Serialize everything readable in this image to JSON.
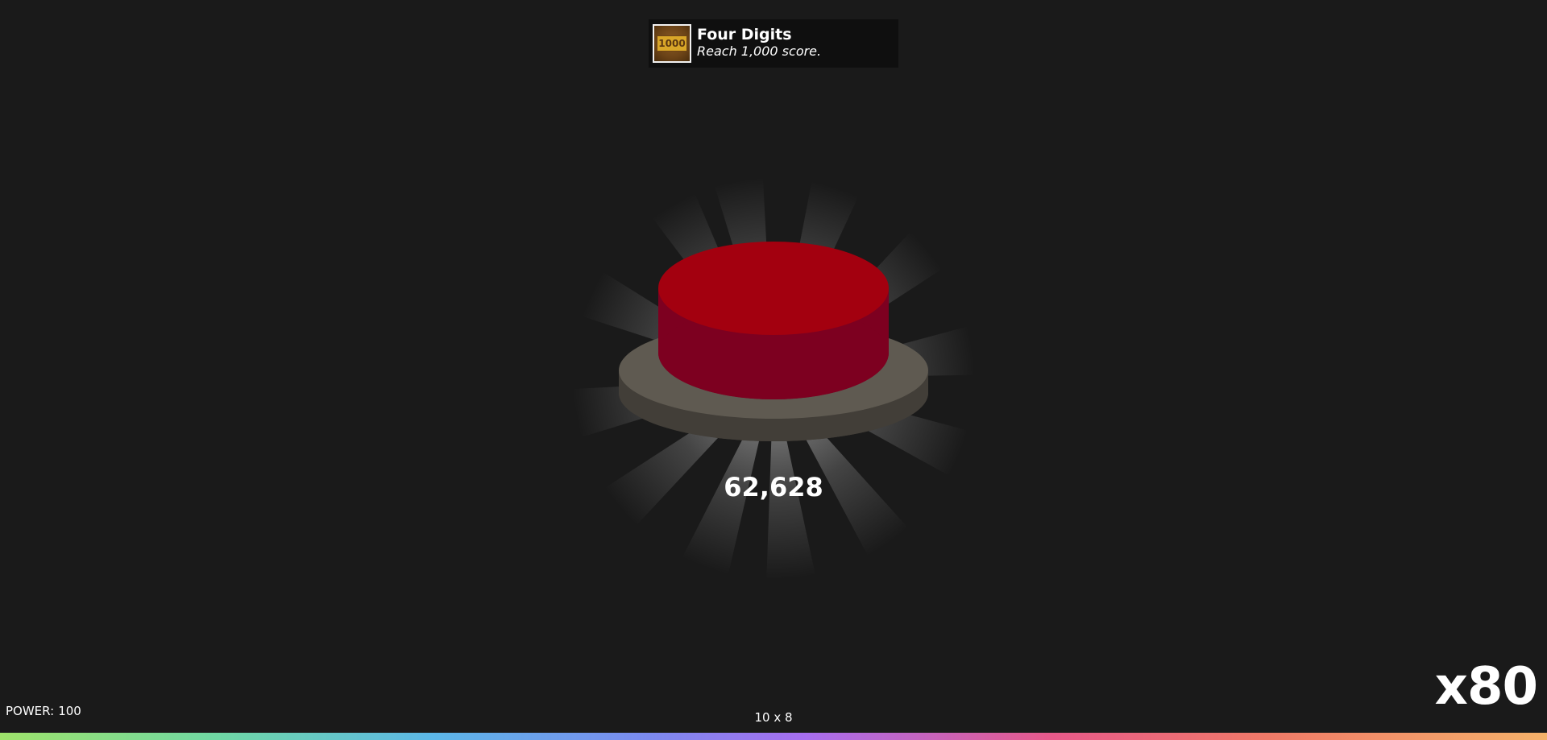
{
  "achievement": {
    "icon": "trophy-1000-badge-icon",
    "icon_text": "1000",
    "title": "Four Digits",
    "description": "Reach 1,000 score."
  },
  "game": {
    "score": "62,628",
    "power_label": "POWER:",
    "power_value": "100",
    "grid_size": "10 x 8",
    "multiplier": "x80"
  },
  "colors": {
    "background": "#1a1a1a",
    "button_top": "#a3000f",
    "button_side": "#7d0020",
    "base_top": "#5f5a51",
    "base_side": "#423e38",
    "ray_color": "#ffffff"
  }
}
